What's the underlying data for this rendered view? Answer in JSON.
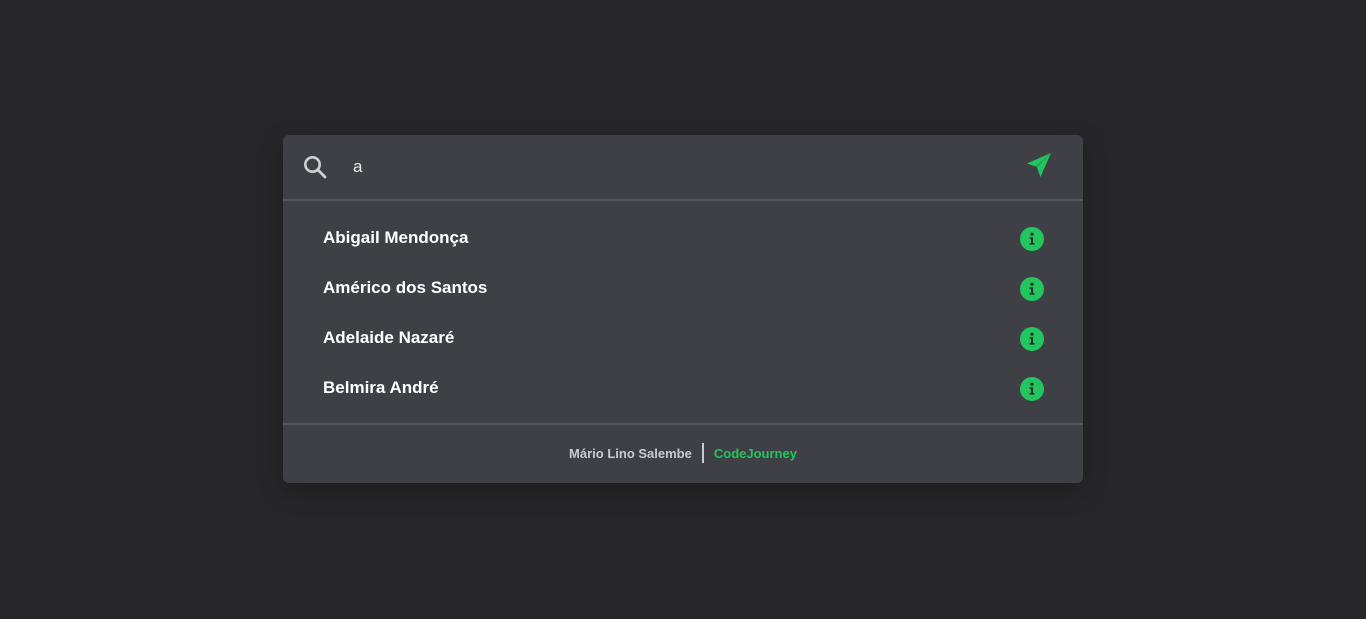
{
  "search": {
    "value": "a",
    "icon": "search-icon",
    "send_icon": "send-icon"
  },
  "results": [
    {
      "name": "Abigail Mendonça",
      "icon": "info-icon"
    },
    {
      "name": "Américo dos Santos",
      "icon": "info-icon"
    },
    {
      "name": "Adelaide Nazaré",
      "icon": "info-icon"
    },
    {
      "name": "Belmira André",
      "icon": "info-icon"
    }
  ],
  "footer": {
    "author": "Mário Lino Salembe",
    "brand": "CodeJourney"
  },
  "colors": {
    "background": "#27272a",
    "card": "#3f4046",
    "accent": "#22c55e",
    "text": "#ffffff"
  }
}
